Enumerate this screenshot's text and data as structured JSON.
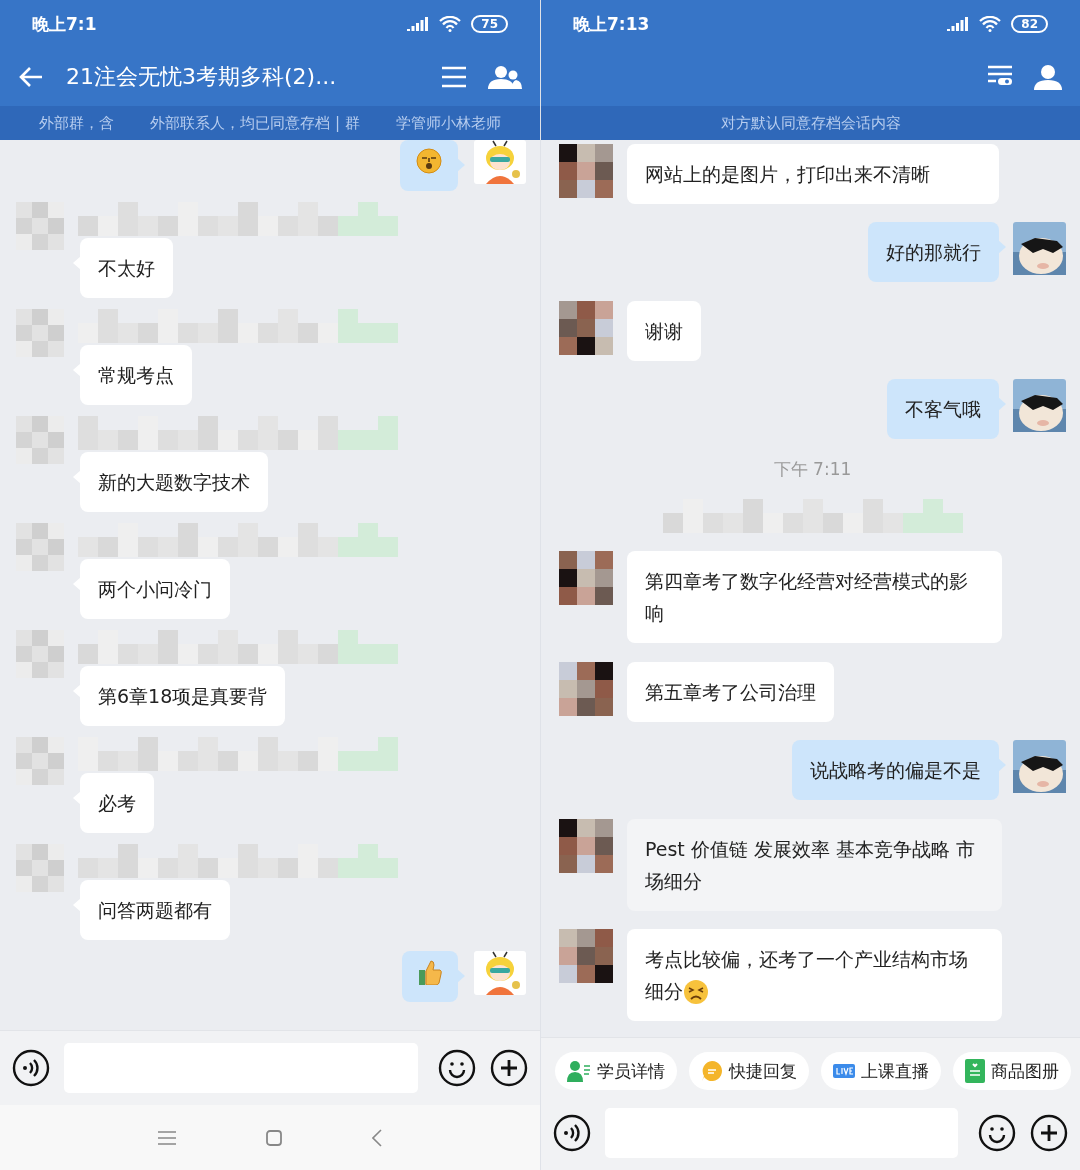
{
  "left_screen": {
    "status_bar": {
      "time": "晚上7:1",
      "battery": "75"
    },
    "header": {
      "title": "21注会无忧3考期多科(2)..."
    },
    "notice": {
      "parts": [
        "外部群，含",
        "外部联系人，均已同意存档 | 群",
        "学管师小林老师"
      ]
    },
    "messages": [
      {
        "kind": "outgoing_emoji"
      },
      {
        "kind": "incoming",
        "text": "不太好"
      },
      {
        "kind": "incoming",
        "text": "常规考点"
      },
      {
        "kind": "incoming",
        "text": "新的大题数字技术"
      },
      {
        "kind": "incoming",
        "text": "两个小问冷门"
      },
      {
        "kind": "incoming",
        "text": "第6章18项是真要背"
      },
      {
        "kind": "incoming",
        "text": "必考"
      },
      {
        "kind": "incoming",
        "text": "问答两题都有"
      },
      {
        "kind": "outgoing_thumb"
      }
    ]
  },
  "right_screen": {
    "status_bar": {
      "time": "晚上7:13",
      "battery": "82"
    },
    "notice": {
      "text": "对方默认同意存档会话内容"
    },
    "messages": [
      {
        "kind": "incoming",
        "text": "网站上的是图片，打印出来不清晰"
      },
      {
        "kind": "outgoing",
        "text": "好的那就行"
      },
      {
        "kind": "incoming",
        "text": "谢谢"
      },
      {
        "kind": "outgoing",
        "text": "不客气哦"
      },
      {
        "kind": "time",
        "text": "下午 7:11"
      },
      {
        "kind": "redacted"
      },
      {
        "kind": "incoming",
        "text": "第四章考了数字化经营对经营模式的影响"
      },
      {
        "kind": "incoming",
        "text": "第五章考了公司治理"
      },
      {
        "kind": "outgoing",
        "text": "说战略考的偏是不是"
      },
      {
        "kind": "incoming",
        "text": "Pest  价值链  发展效率  基本竞争战略  市场细分",
        "selected": true
      },
      {
        "kind": "incoming",
        "text": "考点比较偏，还考了一个产业结构市场细分",
        "emoji": true
      }
    ],
    "quick_actions": [
      {
        "kind": "student",
        "label": "学员详情"
      },
      {
        "kind": "reply",
        "label": "快捷回复"
      },
      {
        "kind": "live",
        "label": "上课直播"
      },
      {
        "kind": "catalog",
        "label": "商品图册"
      }
    ]
  }
}
